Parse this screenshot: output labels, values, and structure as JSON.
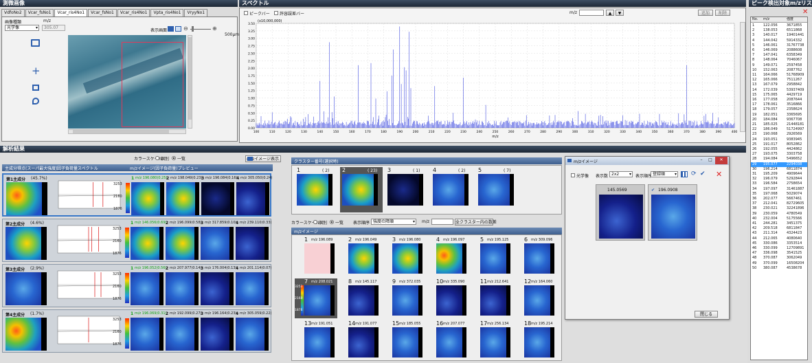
{
  "panels": {
    "tissue": "測微画像",
    "spectrum": "スペクトル",
    "peaks": "ピーク検出対象m/zリスト",
    "analysis": "解析結果"
  },
  "tissue": {
    "tabs": [
      "VdfoNo2",
      "Vcar_fsNo1",
      "Vcar_ris4No1",
      "Vcar_fsNo1",
      "Vcar_ris4No1",
      "Vpta_ris4No1",
      "VryyNo1"
    ],
    "label1": "画像種類",
    "label2": "m/z",
    "select": "光学像",
    "mz": "305.07",
    "display": "表示画面",
    "scale": "500μm"
  },
  "spectrum": {
    "cb1": "ピークバー",
    "cb2": "許容誤差バー",
    "mz_label": "m/z",
    "btn_add": "追加",
    "btn_del": "削除",
    "ymax": "(x10,000,000)",
    "yticks": [
      "3.50",
      "3.25",
      "3.00",
      "2.75",
      "2.50",
      "2.25",
      "2.00",
      "1.75",
      "1.50",
      "1.25",
      "1.00",
      "0.75",
      "0.50",
      "0.25",
      "0.00"
    ],
    "xticks": [
      "100",
      "110",
      "120",
      "130",
      "140",
      "150",
      "160",
      "170",
      "180",
      "190",
      "200",
      "210",
      "220",
      "230",
      "240",
      "250",
      "260",
      "270",
      "280",
      "290",
      "300",
      "310",
      "320",
      "330",
      "340",
      "350",
      "360",
      "370",
      "380",
      "390",
      "400"
    ],
    "xlabel": "m/z"
  },
  "peaks": {
    "headers": [
      "No.",
      "m/z",
      "強度"
    ],
    "rows": [
      [
        "1",
        "122.056",
        "3671855"
      ],
      [
        "2",
        "138.053",
        "6511868"
      ],
      [
        "3",
        "140.017",
        "19401441"
      ],
      [
        "4",
        "144.042",
        "5914332"
      ],
      [
        "5",
        "146.061",
        "31767738"
      ],
      [
        "6",
        "146.069",
        "2088608"
      ],
      [
        "7",
        "147.041",
        "6358349"
      ],
      [
        "8",
        "148.064",
        "7046067"
      ],
      [
        "9",
        "149.071",
        "2597458"
      ],
      [
        "10",
        "152.063",
        "2087762"
      ],
      [
        "11",
        "164.066",
        "51768909"
      ],
      [
        "12",
        "165.066",
        "7511267"
      ],
      [
        "13",
        "167.079",
        "2958842"
      ],
      [
        "14",
        "172.039",
        "53937409"
      ],
      [
        "15",
        "175.065",
        "4429719"
      ],
      [
        "16",
        "177.058",
        "2087644"
      ],
      [
        "17",
        "178.061",
        "3516866"
      ],
      [
        "18",
        "179.057",
        "2358624"
      ],
      [
        "19",
        "182.051",
        "3365695"
      ],
      [
        "20",
        "184.084",
        "9367708"
      ],
      [
        "21",
        "185.025",
        "21448181"
      ],
      [
        "22",
        "186.049",
        "51724997"
      ],
      [
        "23",
        "190.068",
        "2926569"
      ],
      [
        "24",
        "193.051",
        "9383945"
      ],
      [
        "25",
        "191.017",
        "8052862"
      ],
      [
        "26",
        "192.055",
        "4424862"
      ],
      [
        "27",
        "193.075",
        "3303758"
      ],
      [
        "28",
        "194.084",
        "5496652"
      ],
      [
        "29",
        "195.077",
        "2294038"
      ],
      [
        "30",
        "196.214",
        "6811874"
      ],
      [
        "31",
        "195.209",
        "4909644"
      ],
      [
        "32",
        "196.079",
        "5292844"
      ],
      [
        "33",
        "196.584",
        "2758654"
      ],
      [
        "34",
        "197.097",
        "31461887"
      ],
      [
        "35",
        "197.068",
        "5029074"
      ],
      [
        "36",
        "202.077",
        "5667461"
      ],
      [
        "37",
        "212.041",
        "82729605"
      ],
      [
        "38",
        "230.021",
        "32241896"
      ],
      [
        "39",
        "230.059",
        "4780549"
      ],
      [
        "40",
        "232.004",
        "5175566"
      ],
      [
        "41",
        "244.281",
        "3451375"
      ],
      [
        "42",
        "209.518",
        "6811847"
      ],
      [
        "43",
        "211.314",
        "4324423"
      ],
      [
        "44",
        "212.065",
        "4080640"
      ],
      [
        "45",
        "330.086",
        "3353514"
      ],
      [
        "46",
        "330.099",
        "12709891"
      ],
      [
        "47",
        "336.098",
        "3541525"
      ],
      [
        "48",
        "370.087",
        "3062049"
      ],
      [
        "49",
        "370.099",
        "16508204"
      ],
      [
        "50",
        "380.087",
        "4538678"
      ]
    ]
  },
  "analysis": {
    "colorscale": "カラースケール",
    "opt1": "個別",
    "opt2": "一覧",
    "mzimg_btn": "m/zイメージ表示",
    "col1": "主成分得点(スーパ最大強度)",
    "col2": "因子負荷量スペクトル",
    "col3": "m/zイメージ(因子負荷量)プレビュー",
    "components": [
      {
        "name": "第1主成分",
        "pct": "(45.7%)",
        "mz": [
          [
            "1",
            "m/z 196.080(0.25)"
          ],
          [
            "2",
            "m/z 198.049(0.23)"
          ],
          [
            "3",
            "m/z 196.084(0.16)"
          ],
          [
            "4",
            "m/z 305.050(0.24)"
          ]
        ],
        "cs": [
          "3253",
          "2160",
          "1876"
        ]
      },
      {
        "name": "第2主成分",
        "pct": "(4.6%)",
        "mz": [
          [
            "1",
            "m/z 146.056(0.69)"
          ],
          [
            "2",
            "m/z 196.099(0.58)"
          ],
          [
            "3",
            "m/z 317.859(0.10)"
          ],
          [
            "4",
            "m/z 239.110(0.33)"
          ]
        ],
        "cs": [
          "3253",
          "2160",
          "1876"
        ]
      },
      {
        "name": "第3主成分",
        "pct": "(2.9%)",
        "mz": [
          [
            "1",
            "m/z 196.052(0.56)"
          ],
          [
            "2",
            "m/z 207.977(0.14)"
          ],
          [
            "3",
            "m/z 176.004(0.13)"
          ],
          [
            "4",
            "m/z 201.114(0.07)"
          ]
        ],
        "cs": [
          "3253",
          "2160",
          "1876"
        ]
      },
      {
        "name": "第4主成分",
        "pct": "(1.7%)",
        "mz": [
          [
            "1",
            "m/z 196.069(0.31)"
          ],
          [
            "2",
            "m/z 192.099(0.27)"
          ],
          [
            "3",
            "m/z 196.164(0.23)"
          ],
          [
            "4",
            "m/z 305.059(0.22)"
          ]
        ],
        "cs": [
          "3253",
          "2160",
          "1876"
        ]
      }
    ]
  },
  "cluster": {
    "title": "クラスター番号(選択時)",
    "items": [
      [
        "1",
        "( 2)"
      ],
      [
        "2",
        "( 23)"
      ],
      [
        "3",
        "( 1)"
      ],
      [
        "4",
        "( 2)"
      ],
      [
        "5",
        "( 7)"
      ]
    ],
    "colorscale": "カラースケール",
    "opt1": "個別",
    "opt2": "一覧",
    "order": "表示順序",
    "order_val": "強度の降順",
    "mz": "m/z",
    "btn": "全クラスター内の数差",
    "mzimg": "m/zイメージ",
    "cs": [
      "3253",
      "2160",
      "1876"
    ],
    "images": [
      [
        "1",
        "m/z 196.089"
      ],
      [
        "2",
        "m/z 196.049"
      ],
      [
        "3",
        "m/z 196.080"
      ],
      [
        "4",
        "m/z 196.097"
      ],
      [
        "5",
        "m/z 195.125"
      ],
      [
        "6",
        "m/z 309.096"
      ],
      [
        "7",
        "m/z 208.021"
      ],
      [
        "8",
        "m/z 145.117"
      ],
      [
        "9",
        "m/z 372.035"
      ],
      [
        "10",
        "m/z 335.090"
      ],
      [
        "11",
        "m/z 212.641"
      ],
      [
        "12",
        "m/z 164.060"
      ],
      [
        "13",
        "m/z 191.051"
      ],
      [
        "14",
        "m/z 191.077"
      ],
      [
        "15",
        "m/z 185.055"
      ],
      [
        "16",
        "m/z 207.077"
      ],
      [
        "17",
        "m/z 256.134"
      ],
      [
        "18",
        "m/z 195.214"
      ]
    ]
  },
  "popup": {
    "title": "m/zイメージ",
    "cb": "光学像",
    "display_label": "表示数",
    "display_val": "2x2",
    "order_label": "表示順序",
    "order_val": "登録順",
    "img1": "145.0569",
    "img2": "196.0908",
    "close": "閉じる"
  }
}
